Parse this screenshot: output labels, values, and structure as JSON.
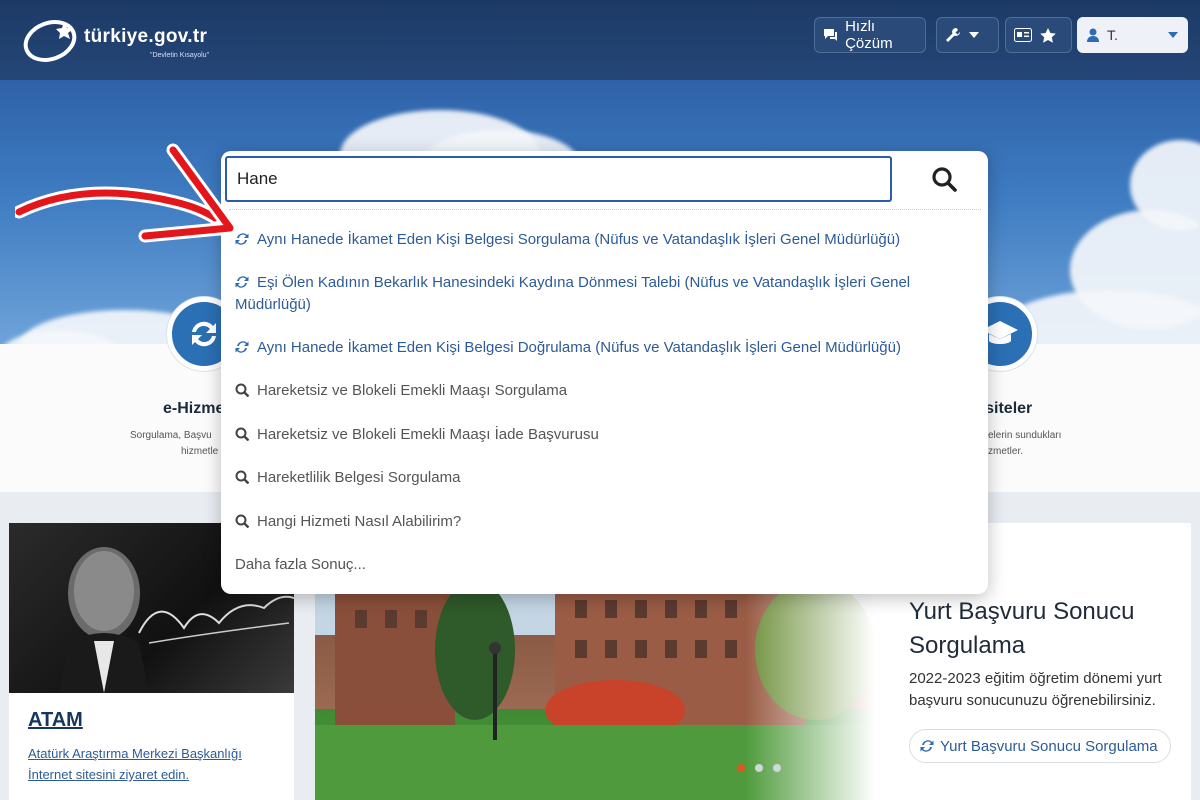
{
  "header": {
    "logo_text": "türkiye.gov.tr",
    "logo_sub": "\"Devletin Kısayolu\"",
    "quick_solution_label": "Hızlı Çözüm",
    "user_label": "T."
  },
  "search": {
    "value": "Hane",
    "results": [
      {
        "type": "service",
        "icon": "refresh-icon",
        "text": "Aynı Hanede İkamet Eden Kişi Belgesi Sorgulama (Nüfus ve Vatandaşlık İşleri Genel Müdürlüğü)"
      },
      {
        "type": "service",
        "icon": "refresh-icon",
        "text": "Eşi Ölen Kadının Bekarlık Hanesindeki Kaydına Dönmesi Talebi (Nüfus ve Vatandaşlık İşleri Genel Müdürlüğü)"
      },
      {
        "type": "service",
        "icon": "refresh-icon",
        "text": "Aynı Hanede İkamet Eden Kişi Belgesi Doğrulama (Nüfus ve Vatandaşlık İşleri Genel Müdürlüğü)"
      },
      {
        "type": "search",
        "icon": "search-icon",
        "text": "Hareketsiz ve Blokeli Emekli Maaşı Sorgulama"
      },
      {
        "type": "search",
        "icon": "search-icon",
        "text": "Hareketsiz ve Blokeli Emekli Maaşı İade Başvurusu"
      },
      {
        "type": "search",
        "icon": "search-icon",
        "text": "Hareketlilik Belgesi Sorgulama"
      },
      {
        "type": "search",
        "icon": "search-icon",
        "text": "Hangi Hizmeti Nasıl Alabilirim?"
      }
    ],
    "more_label": "Daha fazla Sonuç..."
  },
  "services": {
    "left_title": "e-Hizme",
    "left_desc_1": "Sorgulama, Başvu",
    "left_desc_2": "hizmetle",
    "right_title": "ersiteler",
    "right_desc_1": "elerin sundukları",
    "right_desc_2": "zmetler."
  },
  "atam": {
    "title": "ATAM",
    "link": "Atatürk Araştırma Merkezi Başkanlığı İnternet sitesini ziyaret edin."
  },
  "yurt": {
    "title": "Yurt Başvuru Sonucu Sorgulama",
    "desc": "2022-2023 eğitim öğretim dönemi yurt başvuru sonucunuzu öğrenebilirsiniz.",
    "button_label": "Yurt Başvuru Sonucu Sorgulama"
  },
  "colors": {
    "accent": "#2d5b97",
    "header": "#1d3a66",
    "arrow": "#e3161b"
  }
}
